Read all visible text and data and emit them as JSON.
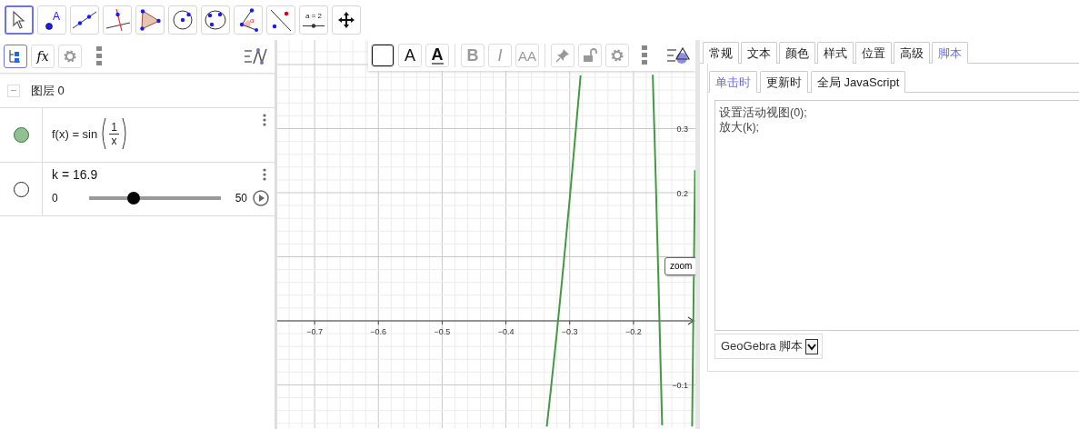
{
  "toolbar": {
    "tools": [
      {
        "kind": "pointer",
        "selected": true
      },
      {
        "kind": "point",
        "label": "A",
        "selected": false
      },
      {
        "kind": "line",
        "selected": false
      },
      {
        "kind": "perpendicular",
        "selected": false
      },
      {
        "kind": "polygon",
        "selected": false
      },
      {
        "kind": "circle",
        "selected": false
      },
      {
        "kind": "circle3",
        "selected": false
      },
      {
        "kind": "angle",
        "label": "α",
        "selected": false
      },
      {
        "kind": "reflect",
        "selected": false
      },
      {
        "kind": "slider",
        "label": "a = 2",
        "selected": false
      },
      {
        "kind": "move",
        "selected": false
      }
    ]
  },
  "algebra": {
    "header": [
      {
        "kind": "tree",
        "selected": true
      },
      {
        "kind": "fx",
        "label": "fx",
        "selected": false
      },
      {
        "kind": "gear",
        "selected": false
      }
    ],
    "group": {
      "label": "图层 0",
      "expanded": true
    },
    "items": [
      {
        "kind": "formula",
        "visible": true,
        "color": "#93c093",
        "lhs": "f(x) = sin",
        "numerator": "1",
        "denominator": "x"
      },
      {
        "kind": "slider",
        "visible": false,
        "label": "k = 16.9",
        "min": "0",
        "max": "50",
        "level": 0.338
      }
    ]
  },
  "graphics": {
    "stylebar": [
      {
        "kind": "swatch"
      },
      {
        "kind": "textcolor",
        "label": "A",
        "disabled": false
      },
      {
        "kind": "bgcolor",
        "label": "A",
        "disabled": false
      },
      {
        "kind": "bold",
        "label": "B",
        "disabled": true
      },
      {
        "kind": "italic",
        "label": "I",
        "disabled": true
      },
      {
        "kind": "size",
        "label": "AA",
        "disabled": true
      },
      {
        "kind": "pin",
        "disabled": true
      },
      {
        "kind": "lock",
        "disabled": true
      },
      {
        "kind": "gear",
        "disabled": true
      }
    ],
    "tooltip": "zoom",
    "chart_data": {
      "type": "line",
      "grid": true,
      "xlim": [
        -0.7586,
        -0.1029
      ],
      "ylim": [
        -0.1674,
        0.4383
      ],
      "xticks": [
        {
          "value": -0.7,
          "label": "−0.7"
        },
        {
          "value": -0.6,
          "label": "−0.6"
        },
        {
          "value": -0.5,
          "label": "−0.5"
        },
        {
          "value": -0.4,
          "label": "−0.4"
        },
        {
          "value": -0.3,
          "label": "−0.3"
        },
        {
          "value": -0.2,
          "label": "−0.2"
        }
      ],
      "yticks": [
        {
          "value": 0.3,
          "label": "0.3"
        },
        {
          "value": 0.2,
          "label": "0.2"
        },
        {
          "value": -0.1,
          "label": "−0.1"
        }
      ],
      "x": [
        -0.336,
        -0.33,
        -0.32,
        -0.31,
        -0.3,
        -0.29,
        -0.2829,
        -0.1698,
        -0.165,
        -0.16,
        -0.1551,
        -0.108,
        -0.106,
        -0.105,
        -0.1035
      ],
      "series": [
        {
          "color": "#449944",
          "values": [
            -0.165,
            -0.111,
            -0.017,
            0.084,
            0.19,
            0.302,
            0.383,
            0.384,
            0.221,
            0.033,
            -0.163,
            -0.165,
            0.009,
            0.099,
            0.235
          ]
        }
      ]
    }
  },
  "properties": {
    "tabs": [
      {
        "label": "常规",
        "selected": false
      },
      {
        "label": "文本",
        "selected": false
      },
      {
        "label": "颜色",
        "selected": false
      },
      {
        "label": "样式",
        "selected": false
      },
      {
        "label": "位置",
        "selected": false
      },
      {
        "label": "高级",
        "selected": false
      },
      {
        "label": "脚本",
        "selected": true
      }
    ],
    "subtabs": [
      {
        "label": "单击时",
        "selected": true
      },
      {
        "label": "更新时",
        "selected": false
      },
      {
        "label": "全局 JavaScript",
        "selected": false
      }
    ],
    "script_lines": [
      "设置活动视图(0);",
      "放大(k);"
    ],
    "language": "GeoGebra 脚本"
  }
}
